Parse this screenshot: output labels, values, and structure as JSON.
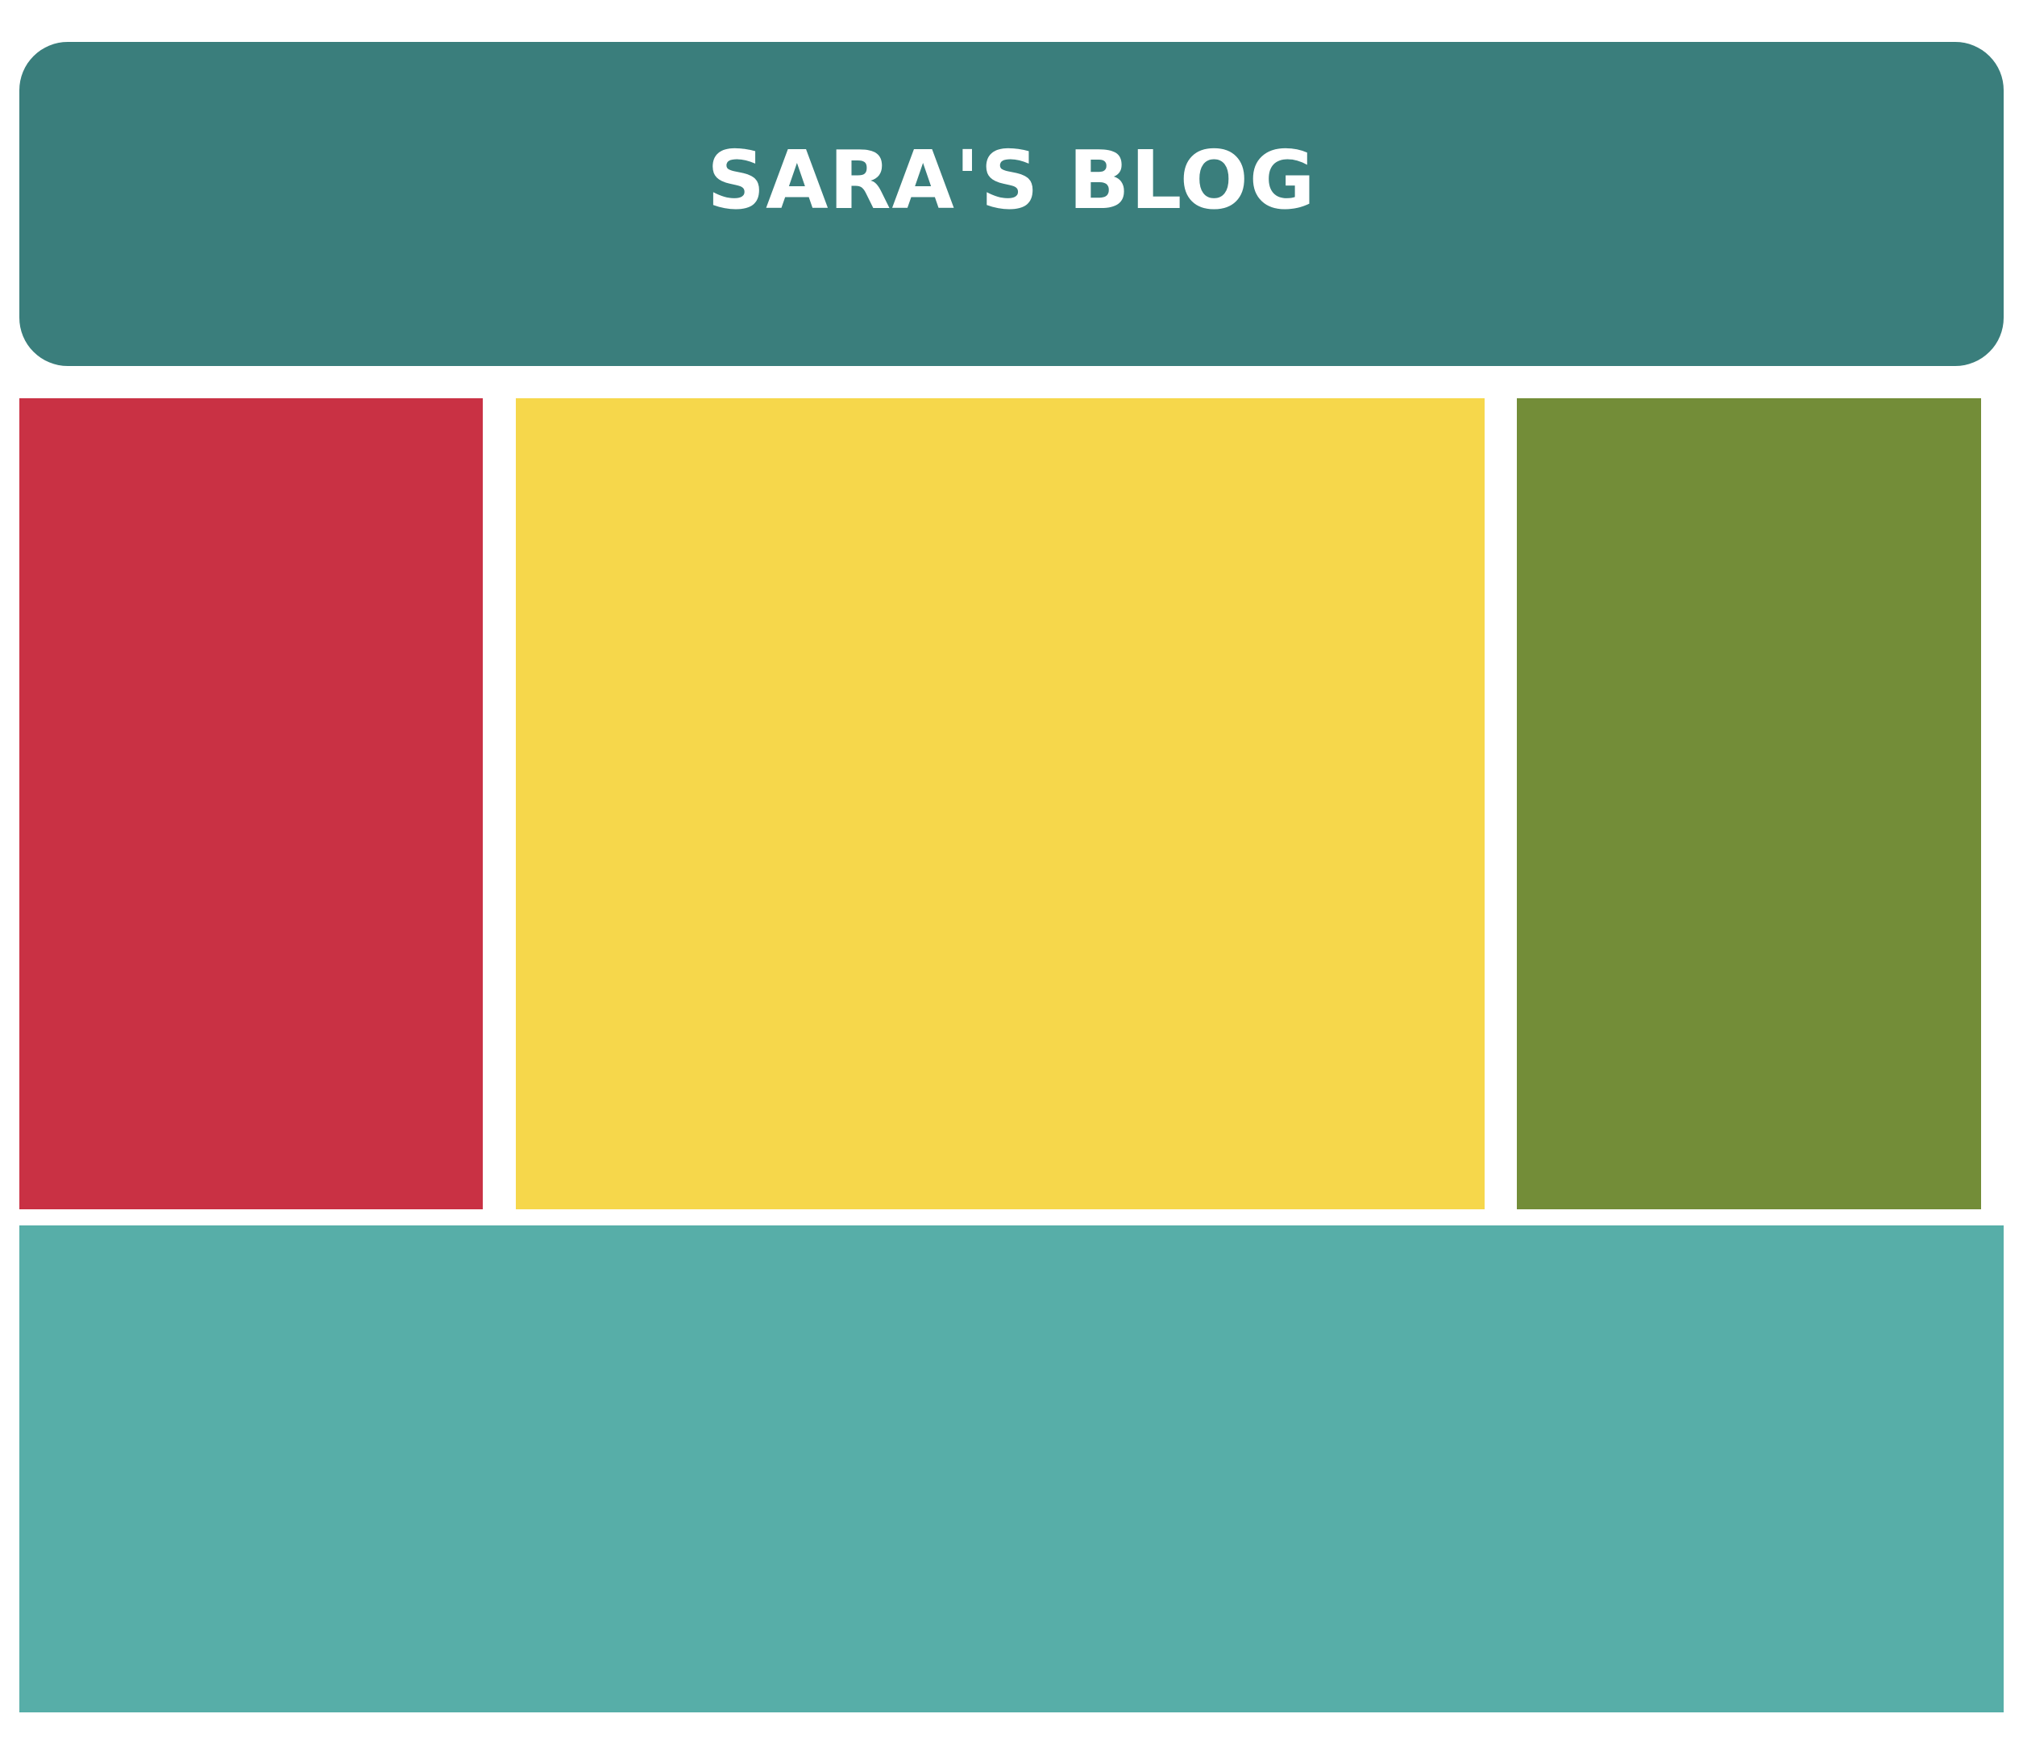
{
  "header": {
    "title": "SARA'S BLOG",
    "background_color": "#3A7E7C",
    "text_color": "#FFFFFF"
  },
  "panels": {
    "left": {
      "color": "#C93144"
    },
    "main": {
      "color": "#F6D74B"
    },
    "right": {
      "color": "#738D38"
    }
  },
  "footer": {
    "color": "#57AEA8"
  },
  "page": {
    "background_color": "#FFFFFF"
  }
}
